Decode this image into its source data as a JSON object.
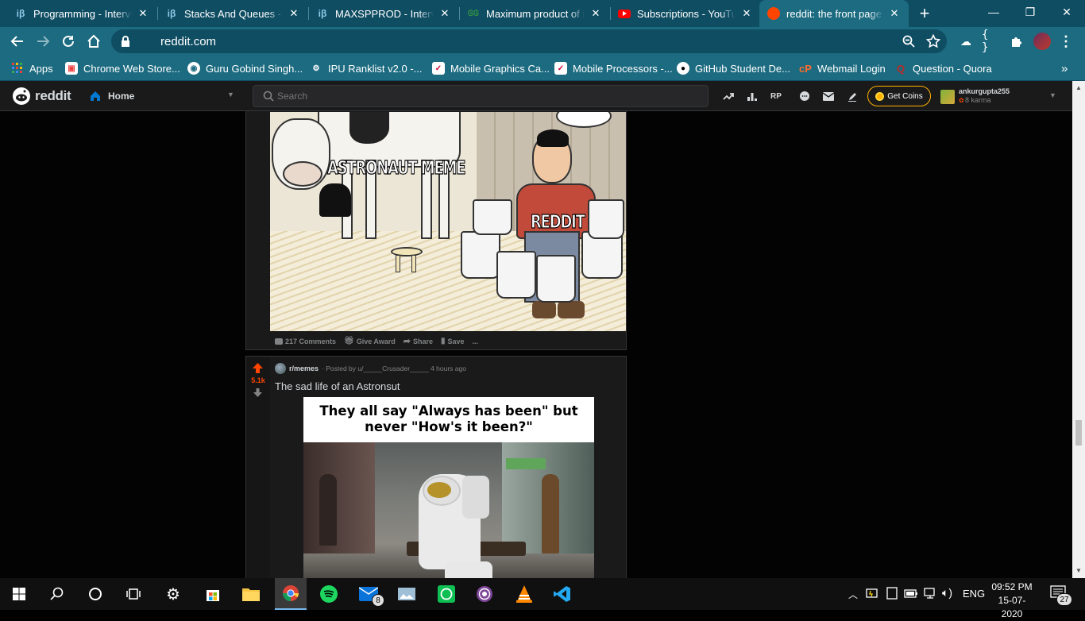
{
  "browser": {
    "tabs": [
      {
        "title": "Programming - Intervie",
        "favicon": "iB",
        "color": "#8ec9e6"
      },
      {
        "title": "Stacks And Queues - Int",
        "favicon": "iB",
        "color": "#8ec9e6"
      },
      {
        "title": "MAXSPPROD - Intervie",
        "favicon": "iB",
        "color": "#8ec9e6"
      },
      {
        "title": "Maximum product of in",
        "favicon": "GG",
        "color": "#2f8d46"
      },
      {
        "title": "Subscriptions - YouTub",
        "favicon": "youtube-icon",
        "color": "#ff0000"
      },
      {
        "title": "reddit: the front page o",
        "favicon": "reddit-icon",
        "color": "#ff4500"
      }
    ],
    "new_tab": "+",
    "window": {
      "minimize": "—",
      "restore": "❐",
      "close": "✕"
    },
    "url": "reddit.com",
    "bookmarks": [
      {
        "label": "Apps"
      },
      {
        "label": "Chrome Web Store..."
      },
      {
        "label": "Guru Gobind Singh..."
      },
      {
        "label": "IPU Ranklist v2.0 -..."
      },
      {
        "label": "Mobile Graphics Ca..."
      },
      {
        "label": "Mobile Processors -..."
      },
      {
        "label": "GitHub Student De..."
      },
      {
        "label": "Webmail Login"
      },
      {
        "label": "Question - Quora"
      }
    ],
    "bookmarks_more": "»"
  },
  "reddit": {
    "logo_text": "reddit",
    "home_label": "Home",
    "search_placeholder": "Search",
    "get_coins": "Get Coins",
    "username": "ankurgupta255",
    "karma": "8 karma"
  },
  "post1": {
    "meme_label_1": "ASTRONAUT MEME",
    "meme_label_2": "REDDIT",
    "comments": "217 Comments",
    "give_award": "Give Award",
    "share": "Share",
    "save": "Save",
    "more": "..."
  },
  "post2": {
    "votes": "5.1k",
    "subreddit": "r/memes",
    "posted_by": "· Posted by u/_____Crusader_____ 4 hours ago",
    "title": "The sad life of an Astronsut",
    "meme_caption": "They all say \"Always has been\" but never \"How's it been?\""
  },
  "taskbar": {
    "lang": "ENG",
    "time": "09:52 PM",
    "date": "15-07-2020",
    "mail_badge": "8",
    "notif_count": "27"
  },
  "colors": {
    "chrome_dark": "#0f4d63",
    "chrome_light": "#1c6b80",
    "reddit_bg": "#030303",
    "card_bg": "#1a1a1b",
    "upvote": "#ff4500",
    "coins": "#ffb000"
  }
}
